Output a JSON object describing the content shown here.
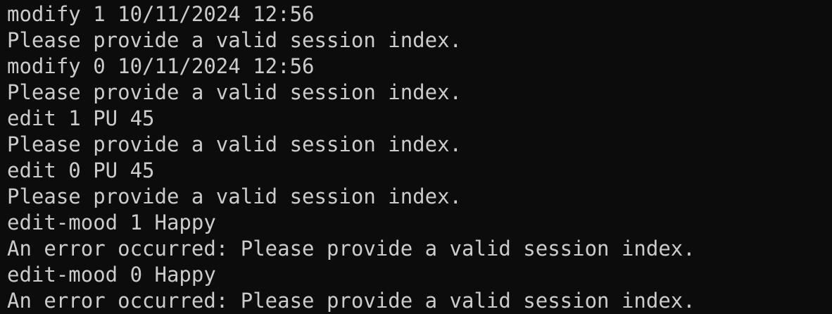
{
  "terminal": {
    "colors": {
      "background": "#0c0c0c",
      "foreground": "#cccccc"
    },
    "lines": [
      "modify 1 10/11/2024 12:56",
      "Please provide a valid session index.",
      "modify 0 10/11/2024 12:56",
      "Please provide a valid session index.",
      "edit 1 PU 45",
      "Please provide a valid session index.",
      "edit 0 PU 45",
      "Please provide a valid session index.",
      "edit-mood 1 Happy",
      "An error occurred: Please provide a valid session index.",
      "edit-mood 0 Happy",
      "An error occurred: Please provide a valid session index."
    ]
  }
}
